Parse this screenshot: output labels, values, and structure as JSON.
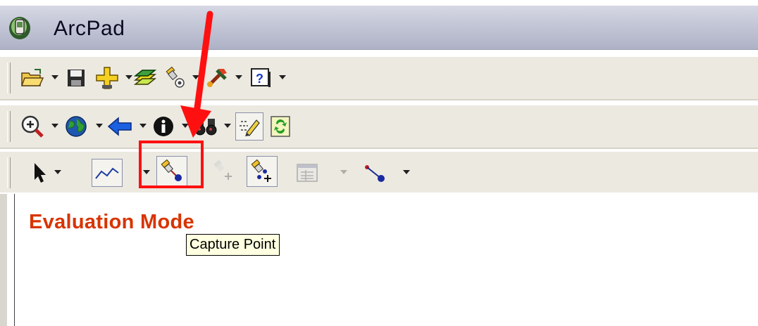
{
  "window": {
    "title": "ArcPad"
  },
  "toolbars": {
    "main": [
      "open-icon",
      "save-icon",
      "add-layer-icon",
      "layers-icon",
      "gps-icon",
      "tools-icon",
      "help-icon"
    ],
    "navigation": [
      "zoom-in-icon",
      "globe-icon",
      "back-icon",
      "info-icon",
      "find-icon",
      "edit-icon",
      "refresh-icon"
    ],
    "edit": [
      "select-icon",
      "polyline-icon",
      "capture-point-icon",
      "add-vertex-icon",
      "gps-vertices-icon",
      "attributes-icon",
      "line-icon"
    ]
  },
  "content": {
    "evaluation_label": "Evaluation Mode"
  },
  "tooltip": {
    "text": "Capture Point"
  },
  "colors": {
    "annotation": "#ff1010",
    "evaluation_text": "#d83400",
    "tooltip_bg": "#ffffe1"
  }
}
